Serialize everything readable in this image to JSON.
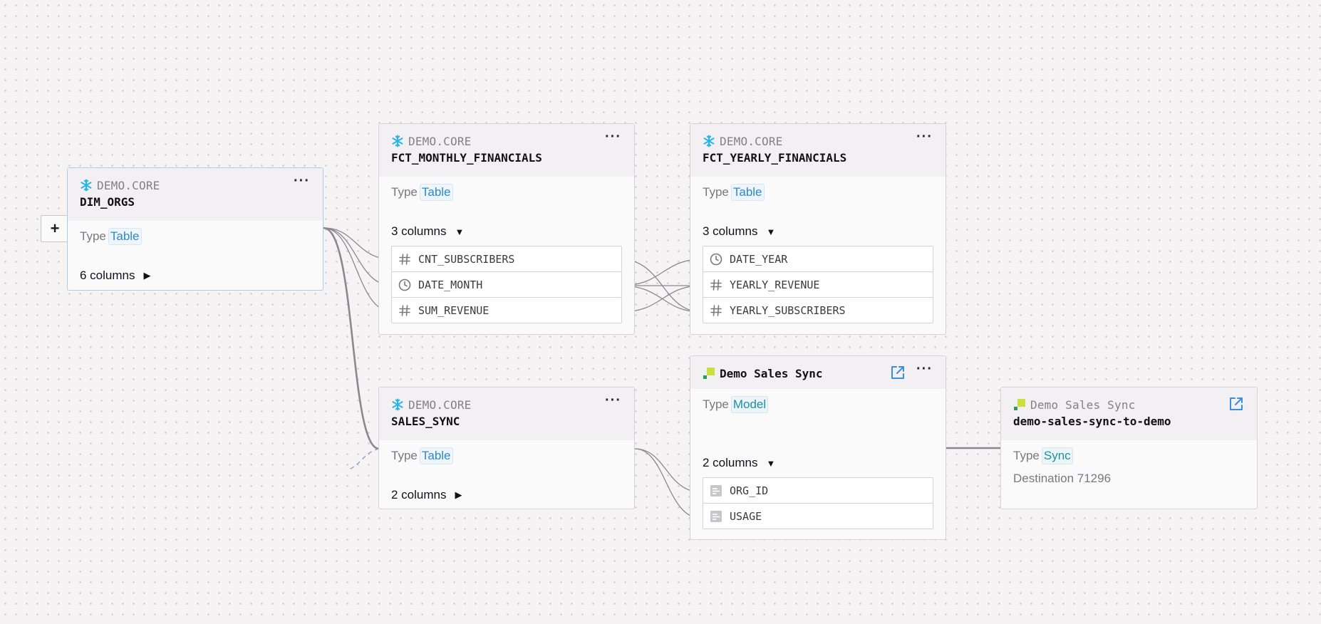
{
  "nodes": {
    "dim_orgs": {
      "schema": "DEMO.CORE",
      "title": "DIM_ORGS",
      "type_label": "Type",
      "type_value": "Table",
      "columns_label": "6 columns"
    },
    "fct_monthly": {
      "schema": "DEMO.CORE",
      "title": "FCT_MONTHLY_FINANCIALS",
      "type_label": "Type",
      "type_value": "Table",
      "columns_label": "3 columns",
      "columns": [
        {
          "name": "CNT_SUBSCRIBERS",
          "icon": "hash-icon"
        },
        {
          "name": "DATE_MONTH",
          "icon": "clock-icon"
        },
        {
          "name": "SUM_REVENUE",
          "icon": "hash-icon"
        }
      ]
    },
    "fct_yearly": {
      "schema": "DEMO.CORE",
      "title": "FCT_YEARLY_FINANCIALS",
      "type_label": "Type",
      "type_value": "Table",
      "columns_label": "3 columns",
      "columns": [
        {
          "name": "DATE_YEAR",
          "icon": "clock-icon"
        },
        {
          "name": "YEARLY_REVENUE",
          "icon": "hash-icon"
        },
        {
          "name": "YEARLY_SUBSCRIBERS",
          "icon": "hash-icon"
        }
      ]
    },
    "sales_sync": {
      "schema": "DEMO.CORE",
      "title": "SALES_SYNC",
      "type_label": "Type",
      "type_value": "Table",
      "columns_label": "2 columns"
    },
    "demo_sales_model": {
      "title": "Demo Sales Sync",
      "type_label": "Type",
      "type_value": "Model",
      "columns_label": "2 columns",
      "columns": [
        {
          "name": "ORG_ID",
          "icon": "text-field-icon"
        },
        {
          "name": "USAGE",
          "icon": "text-field-icon"
        }
      ]
    },
    "demo_sync": {
      "schema": "Demo Sales Sync",
      "title": "demo-sales-sync-to-demo",
      "type_label": "Type",
      "type_value": "Sync",
      "destination": "Destination 71296"
    }
  },
  "icons": {
    "snowflake": "snowflake-icon",
    "hightouch": "hightouch-logo-icon",
    "external": "external-link-icon",
    "menu": "more-horizontal-icon"
  },
  "controls": {
    "expand_label": "+",
    "menu_glyph": "···",
    "caret_right": "▶",
    "caret_down": "▼"
  },
  "colors": {
    "snowflake": "#29b5e8",
    "link_blue": "#2e88d0",
    "edge": "#8c888d",
    "dashed_edge": "#8f92d8",
    "selected_border": "#a9ccef"
  }
}
